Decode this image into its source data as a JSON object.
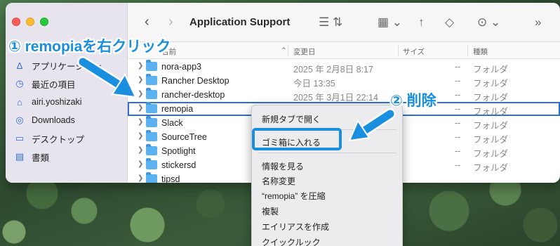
{
  "window": {
    "title": "Application Support"
  },
  "sidebar": {
    "items": [
      {
        "label": "アプリケーション",
        "icon": "applications-icon"
      },
      {
        "label": "最近の項目",
        "icon": "clock-icon"
      },
      {
        "label": "airi.yoshizaki",
        "icon": "home-icon"
      },
      {
        "label": "Downloads",
        "icon": "download-icon"
      },
      {
        "label": "デスクトップ",
        "icon": "desktop-icon"
      },
      {
        "label": "書類",
        "icon": "document-icon"
      }
    ]
  },
  "columns": {
    "name": "名前",
    "date": "変更日",
    "size": "サイズ",
    "kind": "種類"
  },
  "files": [
    {
      "name": "nora-app3",
      "date": "2025 年 2月8日 8:17",
      "size": "--",
      "kind": "フォルダ"
    },
    {
      "name": "Rancher Desktop",
      "date": "今日 13:35",
      "size": "--",
      "kind": "フォルダ"
    },
    {
      "name": "rancher-desktop",
      "date": "2025 年 3月1日 22:14",
      "size": "--",
      "kind": "フォルダ"
    },
    {
      "name": "remopia",
      "date": "",
      "size": "--",
      "kind": "フォルダ"
    },
    {
      "name": "Slack",
      "date": "",
      "size": "--",
      "kind": "フォルダ"
    },
    {
      "name": "SourceTree",
      "date": "",
      "size": "--",
      "kind": "フォルダ"
    },
    {
      "name": "Spotlight",
      "date": "",
      "size": "--",
      "kind": "フォルダ"
    },
    {
      "name": "stickersd",
      "date": "",
      "size": "--",
      "kind": "フォルダ"
    },
    {
      "name": "tipsd",
      "date": "",
      "size": "",
      "kind": ""
    }
  ],
  "context_menu": {
    "items": [
      "新規タブで開く",
      "ゴミ箱に入れる",
      "情報を見る",
      "名称変更",
      "“remopia” を圧縮",
      "複製",
      "エイリアスを作成",
      "クイックルック"
    ]
  },
  "annotations": {
    "step1": "① remopiaを右クリック",
    "step2": "② 削除"
  },
  "colors": {
    "accent": "#1a8fe0",
    "selection": "#2f6fd6",
    "folder": "#5ab3f0"
  }
}
